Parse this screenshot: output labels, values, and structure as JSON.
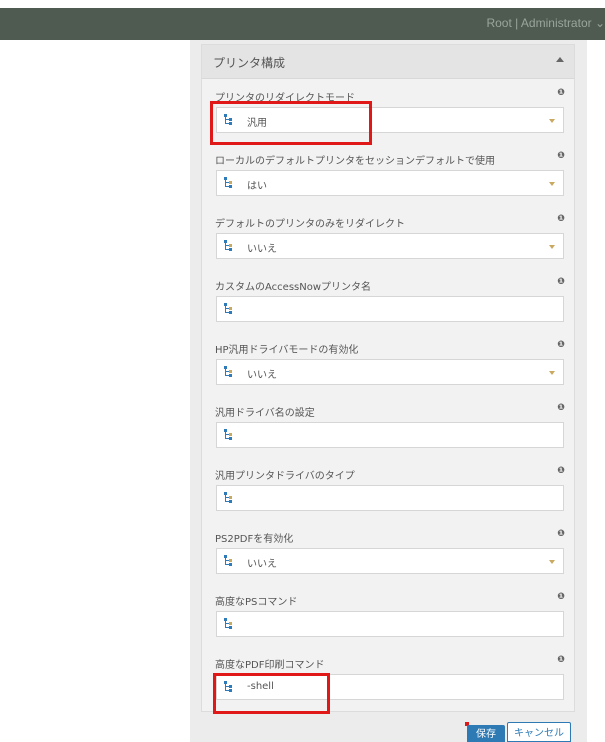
{
  "header": {
    "user": "Root | Administrator ⌄"
  },
  "panel": {
    "title": "プリンタ構成"
  },
  "fields": [
    {
      "label": "プリンタのリダイレクトモード",
      "value": "汎用",
      "type": "select"
    },
    {
      "label": "ローカルのデフォルトプリンタをセッションデフォルトで使用",
      "value": "はい",
      "type": "select"
    },
    {
      "label": "デフォルトのプリンタのみをリダイレクト",
      "value": "いいえ",
      "type": "select"
    },
    {
      "label": "カスタムのAccessNowプリンタ名",
      "value": "",
      "type": "text"
    },
    {
      "label": "HP汎用ドライバモードの有効化",
      "value": "いいえ",
      "type": "select"
    },
    {
      "label": "汎用ドライバ名の設定",
      "value": "",
      "type": "text"
    },
    {
      "label": "汎用プリンタドライバのタイプ",
      "value": "",
      "type": "text"
    },
    {
      "label": "PS2PDFを有効化",
      "value": "いいえ",
      "type": "select"
    },
    {
      "label": "高度なPSコマンド",
      "value": "",
      "type": "text"
    },
    {
      "label": "高度なPDF印刷コマンド",
      "value": "-shell",
      "type": "text"
    }
  ],
  "buttons": {
    "save": "保存",
    "cancel": "キャンセル"
  },
  "colors": {
    "accent": "#2d7ab5",
    "highlight": "#e01818",
    "topbar": "#4f5a51"
  }
}
